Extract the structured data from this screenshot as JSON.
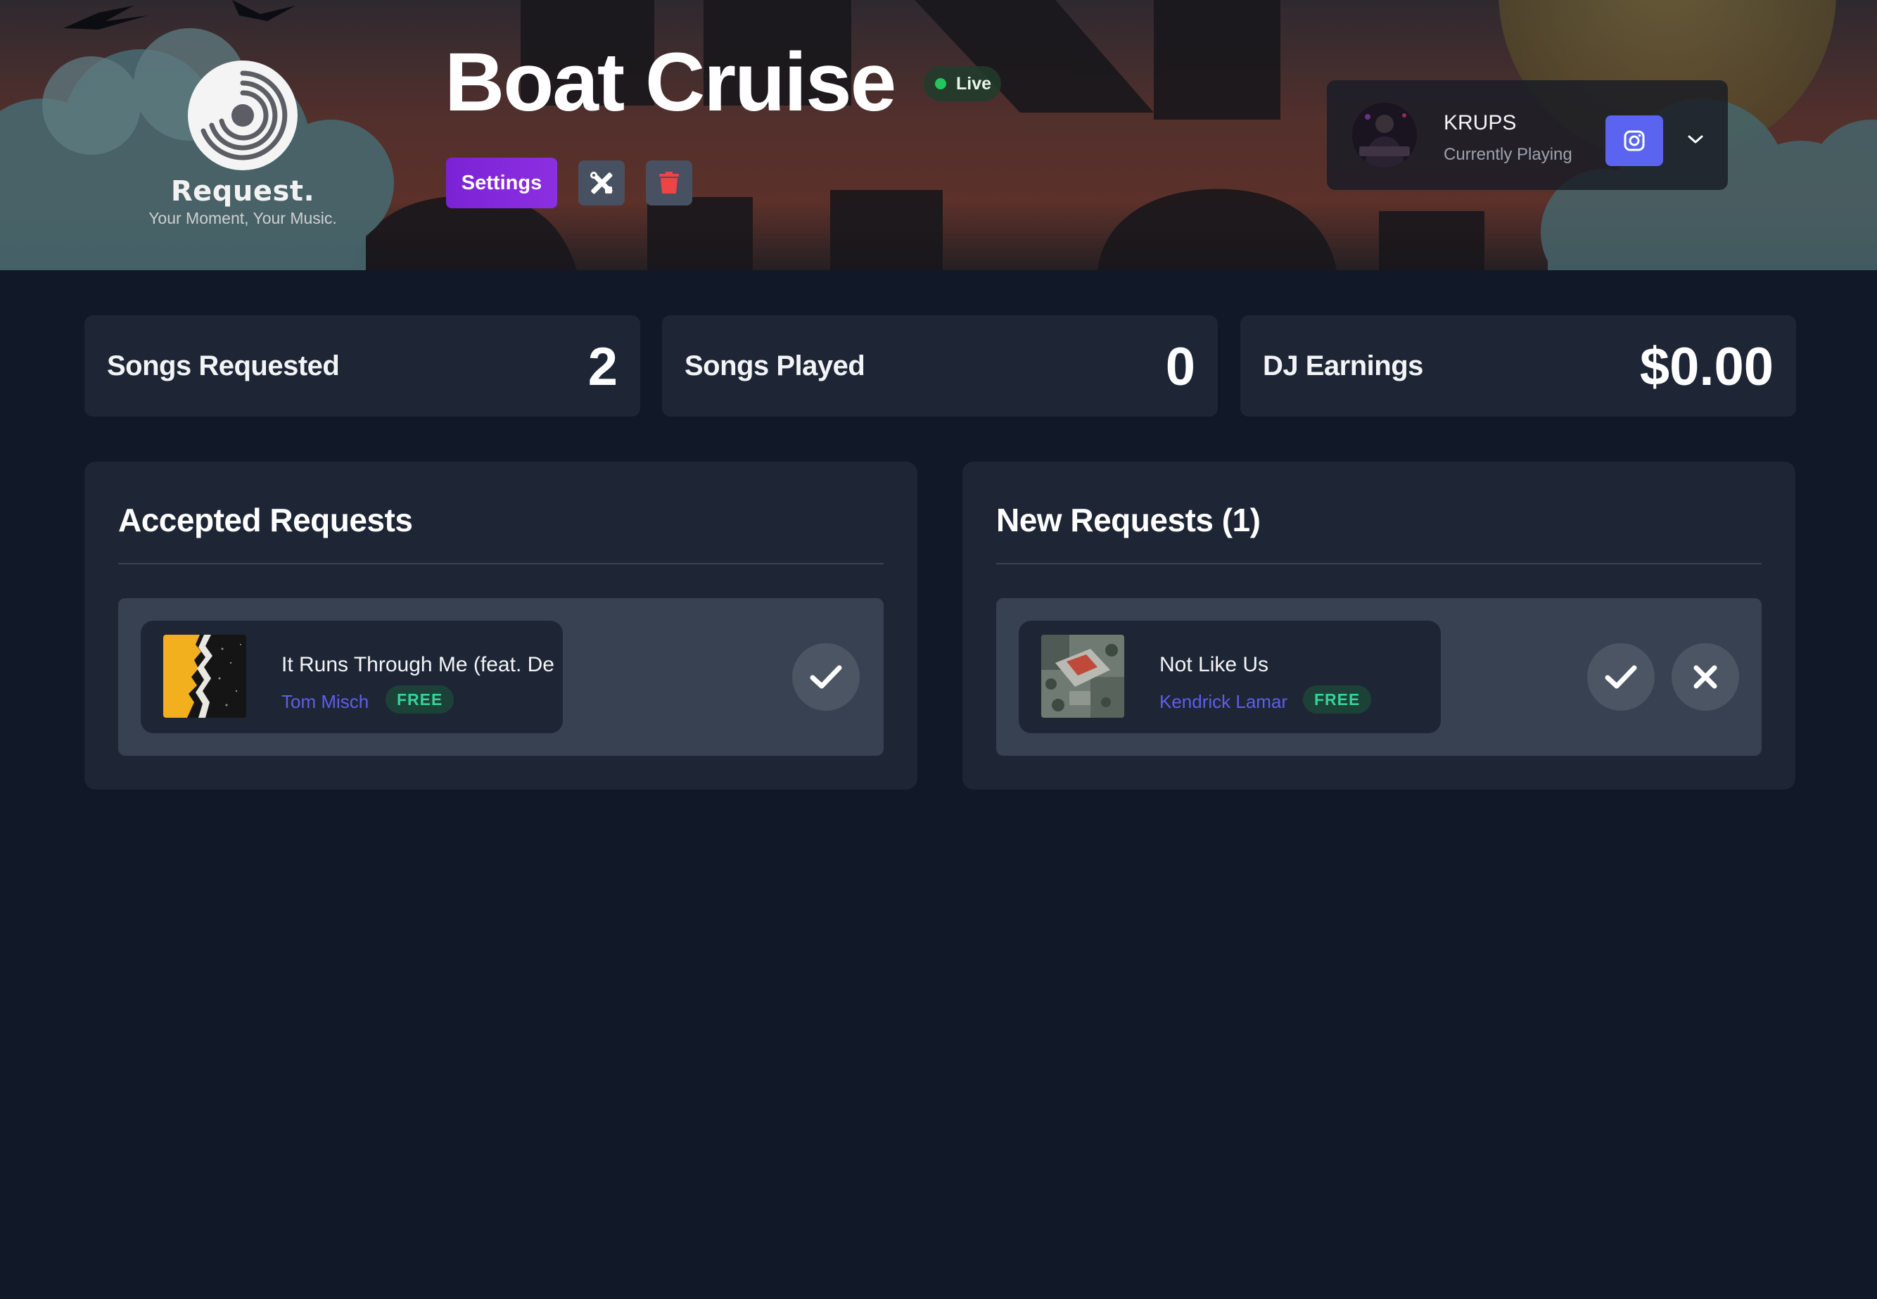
{
  "brand": {
    "name": "Request.",
    "tagline": "Your Moment, Your Music."
  },
  "event": {
    "title": "Boat Cruise",
    "status": "Live",
    "settings_label": "Settings",
    "tools_icon": "tools-icon",
    "delete_icon": "trash-icon"
  },
  "dj": {
    "name": "KRUPS",
    "status": "Currently Playing",
    "social_icon": "instagram-icon",
    "menu_icon": "chevron-down-icon"
  },
  "stats": [
    {
      "label": "Songs Requested",
      "value": "2"
    },
    {
      "label": "Songs Played",
      "value": "0"
    },
    {
      "label": "DJ Earnings",
      "value": "$0.00"
    }
  ],
  "accepted": {
    "title": "Accepted Requests",
    "items": [
      {
        "title": "It Runs Through Me (feat. De La Soul)",
        "artist": "Tom Misch",
        "price": "FREE",
        "action_icon": "check-icon"
      }
    ]
  },
  "new_requests": {
    "title": "New Requests (1)",
    "items": [
      {
        "title": "Not Like Us",
        "artist": "Kendrick Lamar",
        "price": "FREE",
        "accept_icon": "check-icon",
        "reject_icon": "close-icon"
      }
    ]
  },
  "colors": {
    "background": "#111827",
    "card": "#1e2636",
    "row": "#374151",
    "accent_purple": "#7c22d6",
    "instagram": "#5b64f0",
    "live_green": "#22c55e",
    "free_green": "#34d399",
    "artist_link": "#5d5fe6",
    "danger": "#ef4444"
  }
}
